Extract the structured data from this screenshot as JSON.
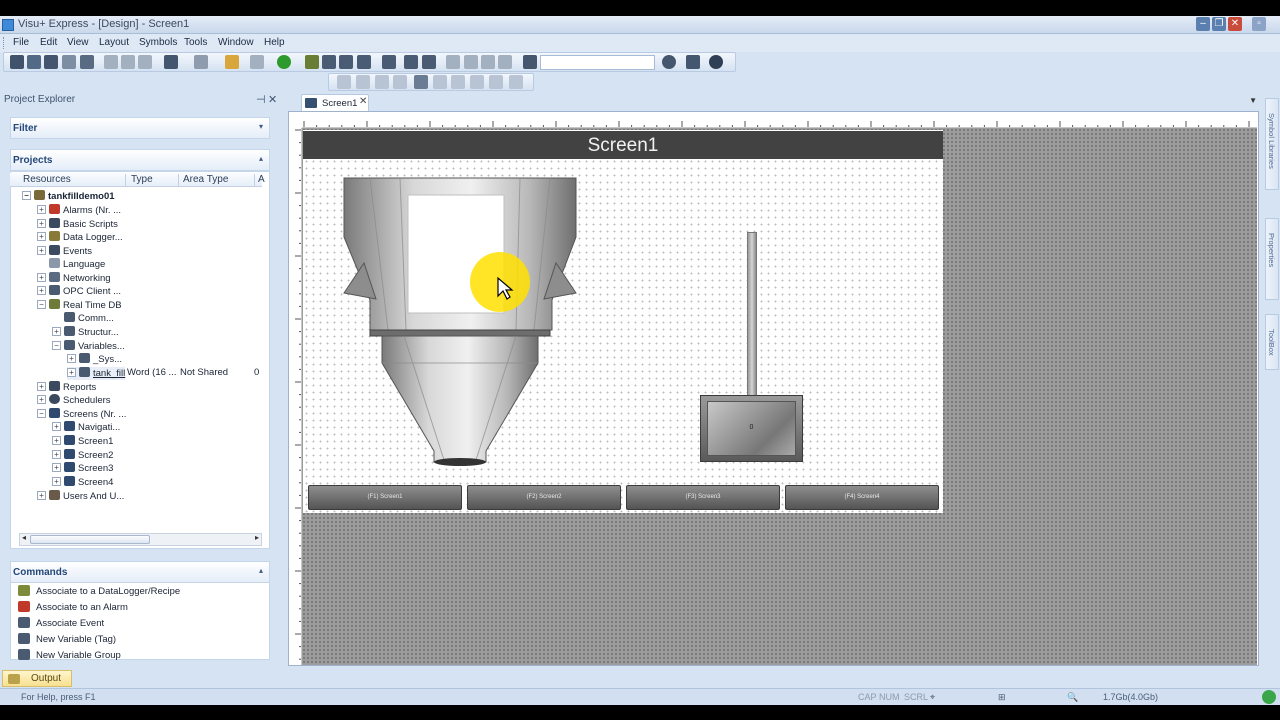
{
  "window": {
    "title": "Visu+ Express - [Design] - Screen1"
  },
  "menu": [
    "File",
    "Edit",
    "View",
    "Layout",
    "Symbols",
    "Tools",
    "Window",
    "Help"
  ],
  "project_explorer": {
    "title": "Project Explorer",
    "filter_label": "Filter",
    "projects_label": "Projects",
    "columns": [
      "Resources",
      "Type",
      "Area Type",
      "A"
    ],
    "tree": [
      {
        "label": "tankfilldemo01",
        "bold": true
      },
      {
        "label": "Alarms (Nr. ..."
      },
      {
        "label": "Basic Scripts"
      },
      {
        "label": "Data Logger..."
      },
      {
        "label": "Events"
      },
      {
        "label": "Language"
      },
      {
        "label": "Networking"
      },
      {
        "label": "OPC Client ..."
      },
      {
        "label": "Real Time DB"
      },
      {
        "label": "Comm..."
      },
      {
        "label": "Structur..."
      },
      {
        "label": "Variables..."
      },
      {
        "label": "_Sys..."
      },
      {
        "label": "tank_fill"
      },
      {
        "label": "Reports"
      },
      {
        "label": "Schedulers"
      },
      {
        "label": "Screens (Nr. ..."
      },
      {
        "label": "Navigati..."
      },
      {
        "label": "Screen1"
      },
      {
        "label": "Screen2"
      },
      {
        "label": "Screen3"
      },
      {
        "label": "Screen4"
      },
      {
        "label": "Users And U..."
      }
    ],
    "tank_fill_row": {
      "type": "Word (16 ...",
      "area_type": "Not Shared",
      "a": "0"
    }
  },
  "commands": {
    "title": "Commands",
    "items": [
      "Associate to a DataLogger/Recipe",
      "Associate to an Alarm",
      "Associate Event",
      "New Variable (Tag)",
      "New Variable Group"
    ]
  },
  "output_tab": "Output",
  "status": {
    "help": "For Help, press F1",
    "caps": "CAP",
    "num": "NUM",
    "scrl": "SCRL",
    "memory": "1.7Gb(4.0Gb)"
  },
  "document": {
    "tab_label": "Screen1",
    "screen_title": "Screen1",
    "nav_buttons": [
      "(F1) Screen1",
      "(F2) Screen2",
      "(F3) Screen3",
      "(F4) Screen4"
    ],
    "display_value": "0"
  },
  "side_tabs": [
    "Symbol Libraries",
    "Properties",
    "ToolBox"
  ],
  "colors": {
    "chrome": "#d6e3f3",
    "screen_title_bar": "#424242",
    "canvas_gray": "#9c9c9c",
    "cursor_highlight": "#ffe000"
  }
}
